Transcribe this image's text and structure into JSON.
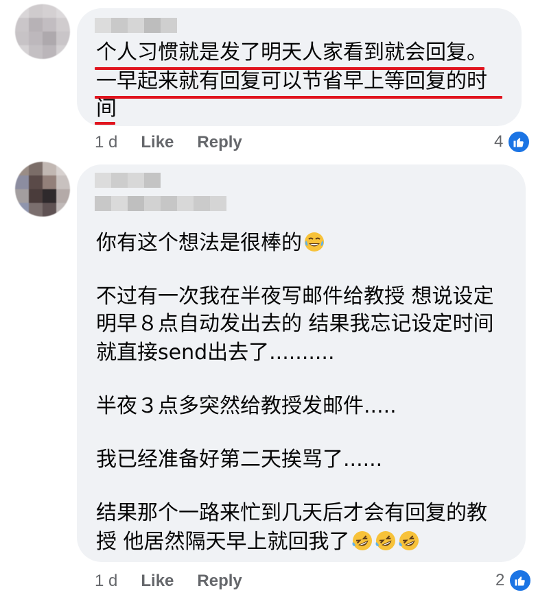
{
  "comments": [
    {
      "lines": [
        "个人习惯就是发了明天人家看到就会回复。",
        "一早起来就有回复可以节省早上等回复的时",
        "间"
      ],
      "time": "1 d",
      "like_label": "Like",
      "reply_label": "Reply",
      "reaction_count": "4",
      "reaction_icon": "like-icon"
    },
    {
      "lines": [
        "你有这个想法是很棒的",
        "",
        "不过有一次我在半夜写邮件给教授 想说设定",
        "明早８点自动发出去的 结果我忘记设定时间",
        "就直接send出去了..........",
        "",
        "半夜３点多突然给教授发邮件.....",
        "",
        "我已经准备好第二天挨骂了......",
        "",
        "结果那个一路来忙到几天后才会有回复的教",
        "授 他居然隔天早上就回我了"
      ],
      "emoji_after_line_1": [
        "face-with-tears-of-joy"
      ],
      "emoji_after_last_line": [
        "rolling-on-floor-laughing",
        "rolling-on-floor-laughing",
        "rolling-on-floor-laughing"
      ],
      "time": "1 d",
      "like_label": "Like",
      "reply_label": "Reply",
      "reaction_count": "2",
      "reaction_icon": "like-icon"
    }
  ],
  "colors": {
    "bubble": "#f0f2f5",
    "underline": "#e0141e",
    "like_blue": "#1b74e4",
    "meta_text": "#65676b"
  }
}
